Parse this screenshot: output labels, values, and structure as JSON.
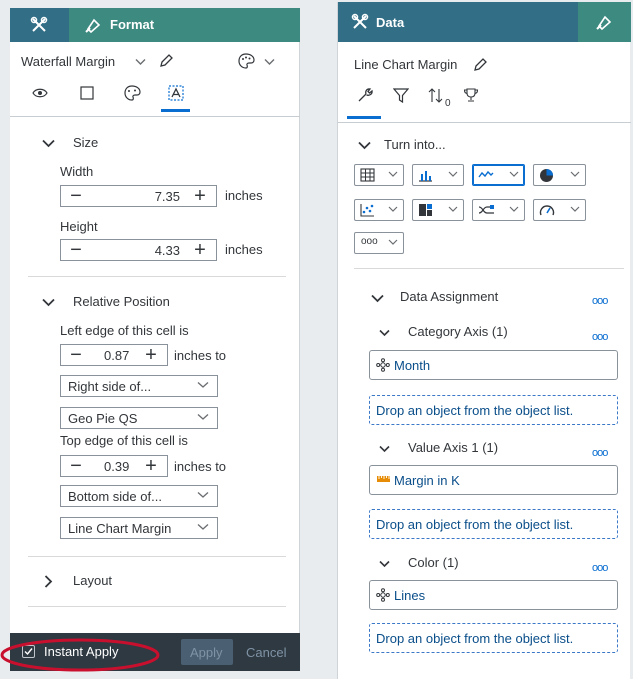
{
  "format_panel": {
    "tab_format_label": "Format",
    "object_name": "Waterfall Margin",
    "size": {
      "title": "Size",
      "width_label": "Width",
      "width_value": "7.35",
      "height_label": "Height",
      "height_value": "4.33",
      "unit": "inches"
    },
    "relative_position": {
      "title": "Relative Position",
      "left_edge_label": "Left edge of this cell is",
      "left_value": "0.87",
      "left_unit": "inches to",
      "left_side_select": "Right side of...",
      "left_object_select": "Geo Pie QS",
      "top_edge_label": "Top edge of this cell is",
      "top_value": "0.39",
      "top_unit": "inches to",
      "top_side_select": "Bottom side of...",
      "top_object_select": "Line Chart Margin"
    },
    "layout_title": "Layout",
    "footer": {
      "instant_apply_label": "Instant Apply",
      "apply_label": "Apply",
      "cancel_label": "Cancel"
    }
  },
  "data_panel": {
    "tab_data_label": "Data",
    "object_name": "Line Chart Margin",
    "sort_subscript": "0",
    "turn_into_title": "Turn into...",
    "data_assignment_title": "Data Assignment",
    "more_label": "ooo",
    "sections": [
      {
        "title": "Category Axis (1)",
        "item": "Month",
        "drop_text": "Drop an object from the object list."
      },
      {
        "title": "Value Axis 1 (1)",
        "item": "Margin in K",
        "drop_text": "Drop an object from the object list."
      },
      {
        "title": "Color (1)",
        "item": "Lines",
        "drop_text": "Drop an object from the object list."
      }
    ]
  },
  "colors": {
    "header_teal": "#3d8a80",
    "header_blue": "#326f87",
    "footer_dark": "#2f3942",
    "accent_blue": "#0a6ed1",
    "annotation_red": "#c8102e"
  }
}
